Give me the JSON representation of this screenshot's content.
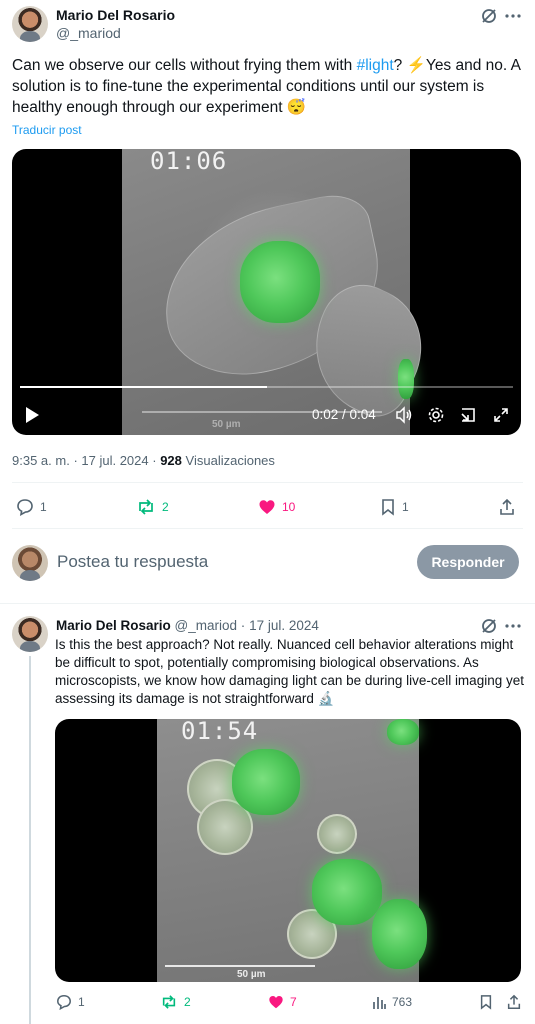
{
  "tweet": {
    "author_name": "Mario Del Rosario",
    "author_handle": "@_mariod",
    "text_parts": {
      "before_link": "Can we observe our cells without frying them with ",
      "link": "#light",
      "after_link": "? ⚡️Yes and no. A solution is to fine-tune the experimental conditions until our system is healthy enough through our experiment 😴"
    },
    "translate_label": "Traducir post",
    "video": {
      "timestamp_overlay": "01:06",
      "time_display": "0:02 / 0:04",
      "scale_label": "50 µm",
      "progress": 0.5
    },
    "meta": {
      "time": "9:35 a. m.",
      "date": "17 jul. 2024",
      "views_count": "928",
      "views_label": "Visualizaciones"
    },
    "actions": {
      "replies": "1",
      "reposts": "2",
      "likes": "10",
      "bookmarks": "1"
    }
  },
  "compose": {
    "placeholder": "Postea tu respuesta",
    "button_label": "Responder"
  },
  "reply_tweet": {
    "author_name": "Mario Del Rosario",
    "author_handle": "@_mariod",
    "date": "17 jul. 2024",
    "text": "Is this the best approach? Not really. Nuanced cell behavior alterations might be difficult to spot, potentially compromising biological observations. As microscopists, we know how damaging light can be during live-cell imaging yet assessing its damage is not straightforward 🔬",
    "video": {
      "timestamp_overlay": "01:54",
      "scale_label": "50 µm"
    },
    "actions": {
      "replies": "1",
      "reposts": "2",
      "likes": "7",
      "views": "763"
    }
  },
  "colors": {
    "link": "#1d9bf0",
    "repost_green": "#00ba7c",
    "like_pink": "#f91880",
    "muted": "#536471"
  }
}
